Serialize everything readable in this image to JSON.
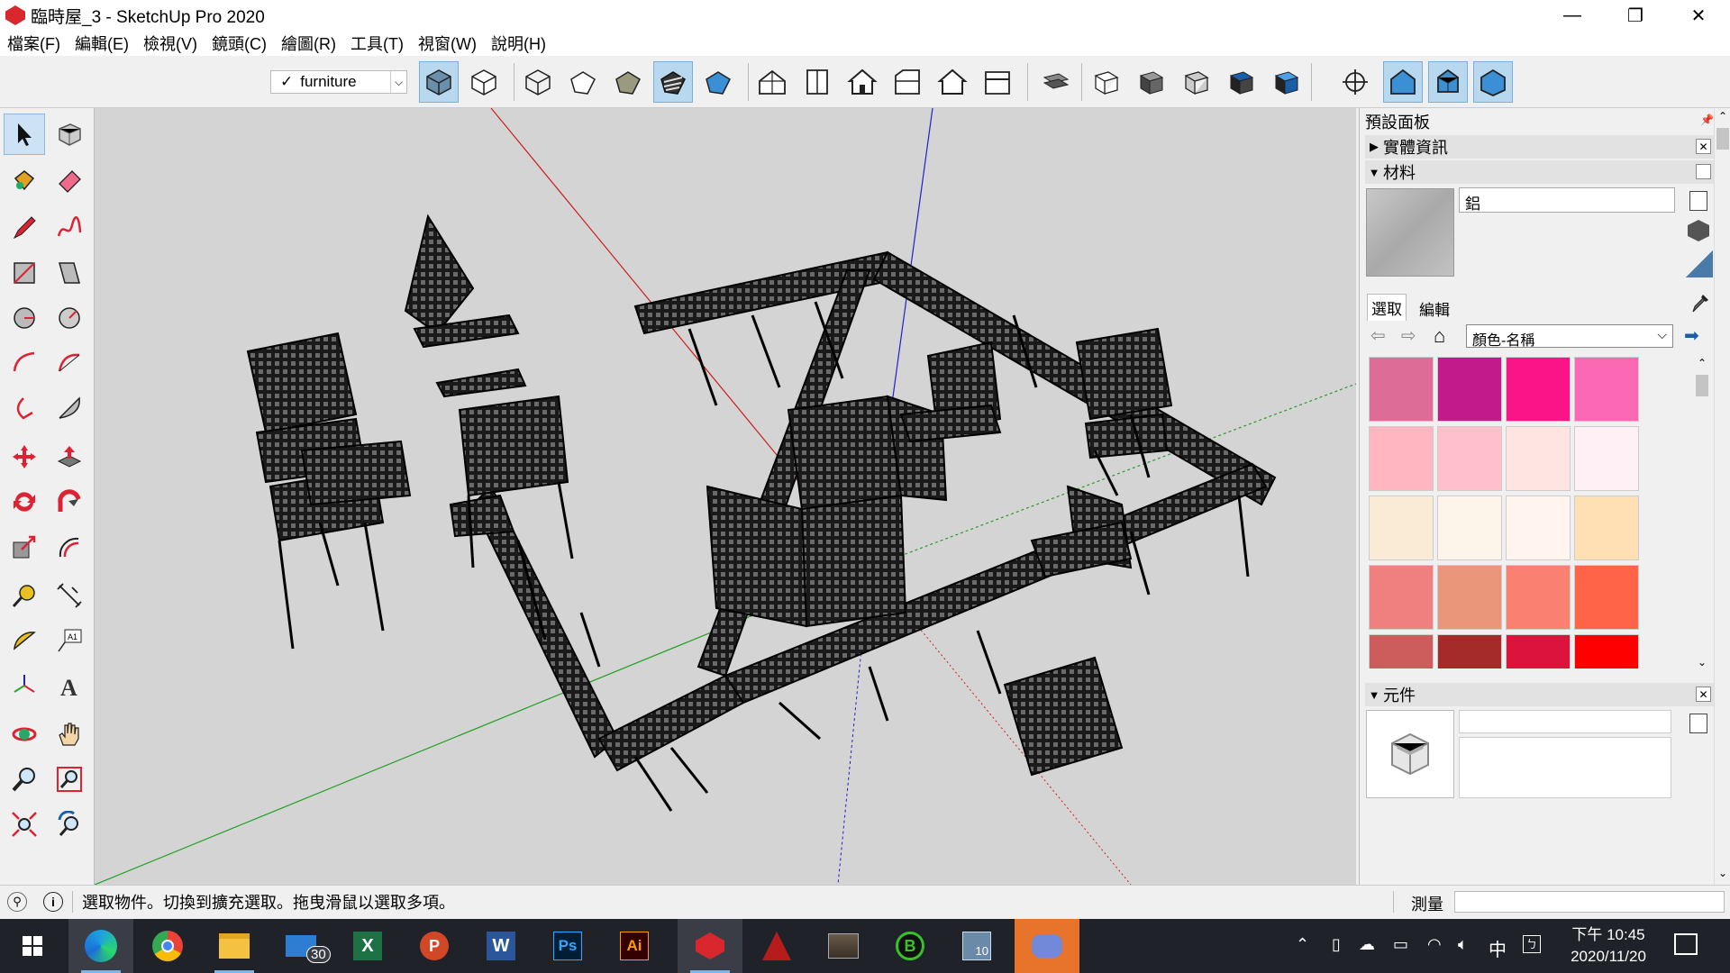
{
  "window": {
    "title": "臨時屋_3 - SketchUp Pro 2020",
    "controls": [
      "—",
      "❐",
      "✕"
    ]
  },
  "menu": [
    "檔案(F)",
    "編輯(E)",
    "檢視(V)",
    "鏡頭(C)",
    "繪圖(R)",
    "工具(T)",
    "視窗(W)",
    "說明(H)"
  ],
  "toolbar": {
    "layer_check": "✓",
    "layer_name": "furniture",
    "layer_dropdown": "⌵"
  },
  "tray": {
    "title": "預設面板",
    "entity_info": {
      "label": "實體資訊",
      "arrow": "▶"
    },
    "materials": {
      "label": "材料",
      "arrow": "▼",
      "name_value": "鋁",
      "tab_select": "選取",
      "tab_edit": "編輯",
      "library": "顏色-名稱"
    },
    "components": {
      "label": "元件",
      "arrow": "▼"
    },
    "close": "✕",
    "swatches": [
      [
        "#dd6d96",
        "#c21a8a",
        "#fb1488",
        "#fb69b4"
      ],
      [
        "#ffb6c1",
        "#ffc0cb",
        "#ffe4e1",
        "#fff0f5"
      ],
      [
        "#faebd7",
        "#fdf5ea",
        "#fff5ee",
        "#ffdfb4"
      ],
      [
        "#f08080",
        "#e9967a",
        "#fa8072",
        "#ff6348"
      ],
      [
        "#cd5c5c",
        "#a52a2a",
        "#dc143c",
        "#ff0000"
      ],
      [
        "#8b0000",
        "#800000",
        "#b22222",
        "#ff4500"
      ]
    ]
  },
  "status": {
    "message": "選取物件。切換到擴充選取。拖曳滑鼠以選取多項。",
    "measure_label": "測量",
    "measure_value": ""
  },
  "taskbar": {
    "mail_badge": "30",
    "tray_ime": "中",
    "time": "下午 10:45",
    "date": "2020/11/20"
  }
}
